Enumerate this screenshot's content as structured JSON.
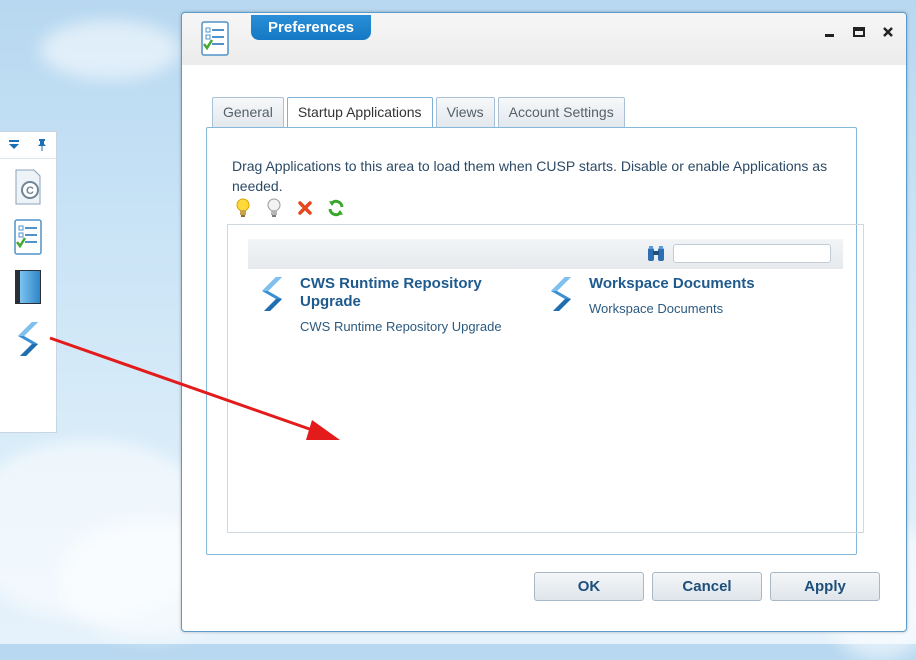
{
  "window": {
    "title": "Preferences",
    "controls": {
      "minimize": "–",
      "maximize": "□",
      "close": "✕"
    }
  },
  "tabs": [
    {
      "label": "General",
      "active": false
    },
    {
      "label": "Startup Applications",
      "active": true
    },
    {
      "label": "Views",
      "active": false
    },
    {
      "label": "Account Settings",
      "active": false
    }
  ],
  "panel": {
    "instructions": "Drag Applications to this area to load them when CUSP starts. Disable or enable Applications as needed.",
    "toolbar_icons": [
      "lightbulb-on-icon",
      "lightbulb-off-icon",
      "remove-icon",
      "refresh-icon"
    ],
    "search": {
      "placeholder": "",
      "value": ""
    },
    "applications": [
      {
        "title": "CWS Runtime Repository Upgrade",
        "description": "CWS Runtime Repository Upgrade",
        "icon": "cusp-app-icon"
      },
      {
        "title": "Workspace Documents",
        "description": "Workspace Documents",
        "icon": "cusp-app-icon"
      }
    ]
  },
  "buttons": {
    "ok": "OK",
    "cancel": "Cancel",
    "apply": "Apply"
  },
  "launcher": {
    "icons": [
      "copyright-document-icon",
      "checklist-icon",
      "book-icon",
      "cusp-app-icon"
    ]
  },
  "colors": {
    "accent": "#1478c4",
    "link": "#1f5a8e",
    "arrow": "#e31b1b"
  }
}
